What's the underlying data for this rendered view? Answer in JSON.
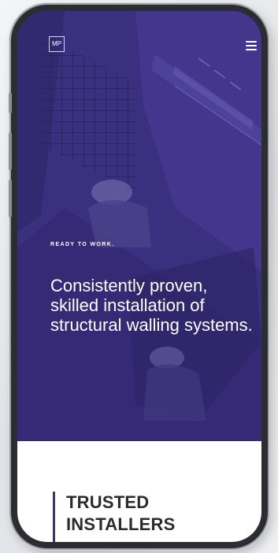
{
  "header": {
    "logo_text": "MP",
    "menu_icon": "hamburger-icon"
  },
  "hero": {
    "eyebrow": "READY TO WORK.",
    "headline": "Consistently proven, skilled installation of structural walling systems."
  },
  "section": {
    "title_line1": "TRUSTED",
    "title_line2": "INSTALLERS"
  },
  "colors": {
    "brand_purple": "#3b2f80",
    "panel_white": "#ffffff",
    "heading_dark": "#2b2b2b"
  }
}
